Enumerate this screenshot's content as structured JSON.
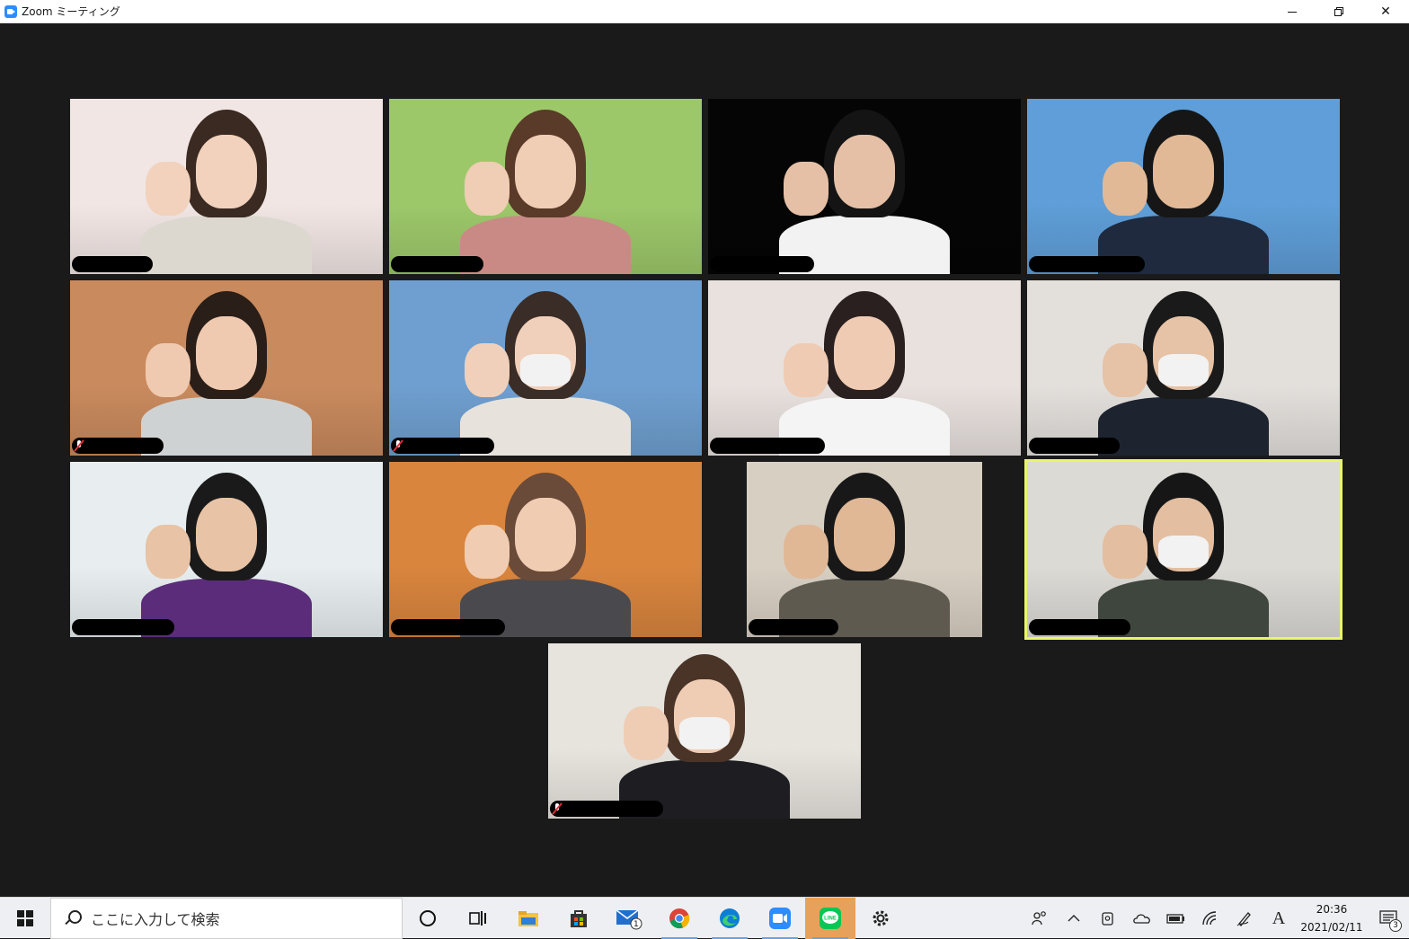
{
  "window": {
    "title": "Zoom ミーティング",
    "controls": [
      "minimize",
      "restore",
      "close"
    ],
    "close_glyph": "✕"
  },
  "gallery": {
    "active_speaker_color": "#e8f56a",
    "tiles": [
      {
        "bg": "#f1e6e4",
        "shirt": "#dcd8d0",
        "hair": "#3a2a22",
        "skin": "#f2d2bc",
        "mask": false,
        "muted": false
      },
      {
        "bg": "#9dc86a",
        "shirt": "#c98a86",
        "hair": "#5a3a28",
        "skin": "#f0cdb5",
        "mask": false,
        "muted": false
      },
      {
        "bg": "#050505",
        "shirt": "#f2f2f2",
        "hair": "#141414",
        "skin": "#e5c0a6",
        "mask": false,
        "muted": false
      },
      {
        "bg": "#5f9ed8",
        "shirt": "#1f2a3e",
        "hair": "#161616",
        "skin": "#e2b996",
        "mask": false,
        "muted": false
      },
      {
        "bg": "#c98a5e",
        "shirt": "#cfd2d2",
        "hair": "#2a1e18",
        "skin": "#efcab0",
        "mask": false,
        "muted": true
      },
      {
        "bg": "#6f9fd0",
        "shirt": "#e7e3dc",
        "hair": "#3a2c26",
        "skin": "#f0d0ba",
        "mask": true,
        "muted": true
      },
      {
        "bg": "#e8e1de",
        "shirt": "#f4f4f4",
        "hair": "#2a2020",
        "skin": "#efcbb3",
        "mask": false,
        "muted": false
      },
      {
        "bg": "#e3e0dc",
        "shirt": "#1d2430",
        "hair": "#1a1a1a",
        "skin": "#e6c2a6",
        "mask": true,
        "muted": false
      },
      {
        "bg": "#e8eef0",
        "shirt": "#5a2c7a",
        "hair": "#1a1a1a",
        "skin": "#e8c3a5",
        "mask": false,
        "muted": false
      },
      {
        "bg": "#d9853e",
        "shirt": "#4a4a4e",
        "hair": "#6a4a38",
        "skin": "#f0ccb2",
        "mask": false,
        "muted": false
      },
      {
        "bg": "#d8cfc3",
        "shirt": "#5e5a50",
        "hair": "#181818",
        "skin": "#e0b896",
        "mask": false,
        "muted": false
      },
      {
        "bg": "#dcdad5",
        "shirt": "#3f463e",
        "hair": "#161616",
        "skin": "#e3bea0",
        "mask": true,
        "muted": false
      },
      {
        "bg": "#e7e4de",
        "shirt": "#1e1e22",
        "hair": "#4a3428",
        "skin": "#efcdb4",
        "mask": true,
        "muted": true
      }
    ]
  },
  "taskbar": {
    "search_placeholder": "ここに入力して検索",
    "apps": [
      "cortana-icon",
      "task-view-icon",
      "file-explorer-icon",
      "store-icon",
      "mail-icon",
      "chrome-icon",
      "edge-icon",
      "zoom-icon",
      "line-icon",
      "settings-icon"
    ],
    "mail_badge": "1",
    "line_label": "LINE",
    "tray": [
      "people-icon",
      "chevron-up-icon",
      "meet-now-icon",
      "onedrive-icon",
      "battery-icon",
      "wifi-icon",
      "pen-icon"
    ],
    "ime_indicator": "A",
    "time": "20:36",
    "date": "2021/02/11",
    "notifications_count": "3"
  }
}
